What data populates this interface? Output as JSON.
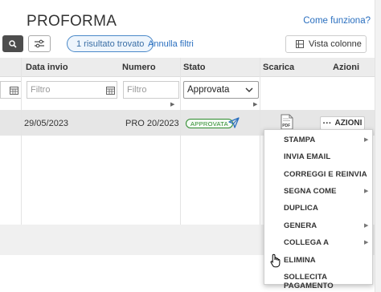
{
  "header": {
    "title": "PROFORMA",
    "help_link": "Come funziona?"
  },
  "toolbar": {
    "results_label": "1 risultato trovato",
    "reset_filters": "Annulla filtri",
    "columns_button": "Vista colonne"
  },
  "table": {
    "columns": [
      "Data invio",
      "Numero",
      "Stato",
      "Scarica",
      "Azioni"
    ],
    "filters": {
      "date_placeholder": "Filtro",
      "number_placeholder": "Filtro",
      "status_value": "Approvata"
    },
    "rows": [
      {
        "date": "29/05/2023",
        "number": "PRO 20/2023",
        "status": "APPROVATA",
        "actions_label": "AZIONI"
      }
    ]
  },
  "actions_menu": {
    "items": [
      "STAMPA",
      "INVIA EMAIL",
      "CORREGGI E REINVIA",
      "SEGNA COME",
      "DUPLICA",
      "GENERA",
      "COLLEGA A",
      "ELIMINA",
      "SOLLECITA PAGAMENTO"
    ]
  },
  "colors": {
    "link": "#2a6fbf",
    "status_green": "#2e8b2e",
    "header_bg": "#ececec"
  },
  "icons": [
    "search-icon",
    "sliders-icon",
    "columns-icon",
    "calendar-icon",
    "chevron-down-icon",
    "send-icon",
    "pdf-icon",
    "ellipsis-icon",
    "submenu-arrow-icon",
    "hand-cursor-icon"
  ]
}
